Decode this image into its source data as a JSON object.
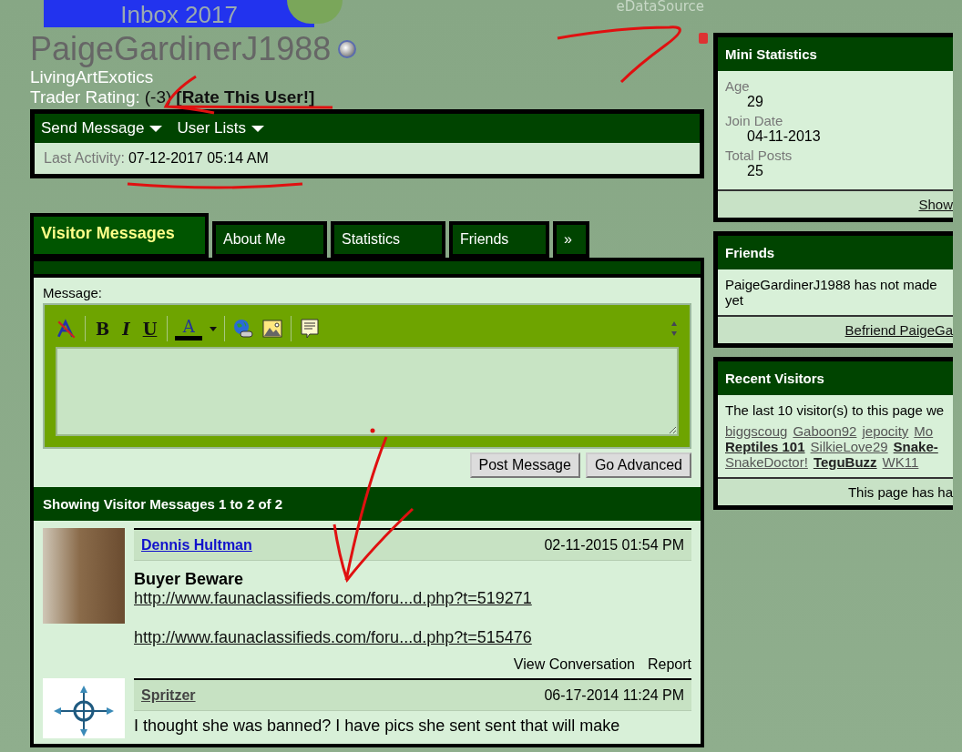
{
  "banner": {
    "title": "Inbox 2017",
    "source": "eDataSource"
  },
  "profile": {
    "username": "PaigeGardinerJ1988",
    "title": "LivingArtExotics",
    "rating_label": "Trader Rating:",
    "rating_value": "(-3)",
    "rate_link": "[Rate This User!]"
  },
  "profile_menu": [
    {
      "label": "Send Message"
    },
    {
      "label": "User Lists"
    }
  ],
  "last_activity": {
    "label": "Last Activity:",
    "value": "07-12-2017 05:14 AM"
  },
  "tabs": [
    {
      "label": "Visitor Messages",
      "selected": true
    },
    {
      "label": "About Me",
      "selected": false
    },
    {
      "label": "Statistics",
      "selected": false
    },
    {
      "label": "Friends",
      "selected": false
    },
    {
      "label": "»",
      "selected": false
    }
  ],
  "editor": {
    "label": "Message:",
    "format_buttons": [
      "B",
      "I",
      "U"
    ],
    "font_color_label": "A",
    "buttons": [
      "Post Message",
      "Go Advanced"
    ]
  },
  "messages_header": "Showing Visitor Messages 1 to 2 of 2",
  "messages": [
    {
      "kind": "photo",
      "author": "Dennis Hultman",
      "visited": false,
      "date": "02-11-2015 01:54 PM",
      "title": "Buyer Beware",
      "links": [
        "http://www.faunaclassifieds.com/foru...d.php?t=519271",
        "http://www.faunaclassifieds.com/foru...d.php?t=515476"
      ],
      "actions": [
        "View Conversation",
        "Report"
      ]
    },
    {
      "kind": "compass",
      "author": "Spritzer",
      "visited": true,
      "date": "06-17-2014 11:24 PM",
      "text": "I thought she was banned? I have pics she sent sent that will make"
    }
  ],
  "mini_statistics": {
    "title": "Mini Statistics",
    "items": [
      {
        "label": "Age",
        "value": "29"
      },
      {
        "label": "Join Date",
        "value": "04-11-2013"
      },
      {
        "label": "Total Posts",
        "value": "25"
      }
    ],
    "footer_link": "Show"
  },
  "friends": {
    "title": "Friends",
    "lines": [
      "PaigeGardinerJ1988 has not made",
      "yet"
    ],
    "footer_link": "Befriend PaigeGa"
  },
  "recent_visitors": {
    "title": "Recent Visitors",
    "intro": "The last 10 visitor(s) to this page we",
    "visitors": [
      {
        "name": "biggscoug",
        "bold": false
      },
      {
        "name": "Gaboon92",
        "bold": false
      },
      {
        "name": "jepocity",
        "bold": false
      },
      {
        "name": "Mo",
        "bold": false
      },
      {
        "name": "Reptiles 101",
        "bold": true
      },
      {
        "name": "SilkieLove29",
        "bold": false
      },
      {
        "name": "Snake-",
        "bold": true
      },
      {
        "name": "SnakeDoctor!",
        "bold": false
      },
      {
        "name": "TeguBuzz",
        "bold": true
      },
      {
        "name": "WK11",
        "bold": false
      }
    ],
    "footer": "This page has ha"
  }
}
